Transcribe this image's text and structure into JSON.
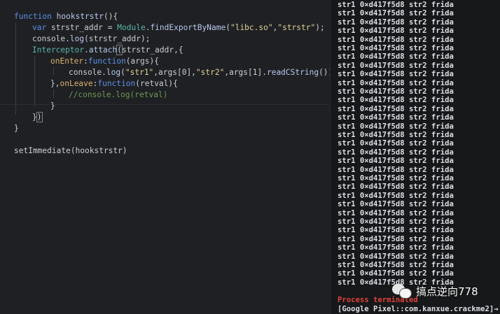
{
  "editor": {
    "lines": {
      "l1": {
        "t1": "function",
        "t2": " ",
        "t3": "hookstrstr",
        "t4": "(){"
      },
      "l2": {
        "t1": "var",
        "t2": " strstr_addr = ",
        "t3": "Module",
        "t4": ".",
        "t5": "findExportByName",
        "t6": "(",
        "t7": "\"libc.so\"",
        "t8": ",",
        "t9": "\"strstr\"",
        "t10": ");"
      },
      "l3": {
        "t1": "console",
        "t2": ".",
        "t3": "log",
        "t4": "(strstr_addr);"
      },
      "l4": {
        "t1": "Interceptor",
        "t2": ".",
        "t3": "attach",
        "t4": "(",
        "t5": "strstr_addr,{"
      },
      "l5": {
        "t1": "onEnter",
        "t2": ":",
        "t3": "function",
        "t4": "(args){"
      },
      "l6": {
        "t1": "console",
        "t2": ".",
        "t3": "log",
        "t4": "(",
        "t5": "\"str1\"",
        "t6": ",args[0],",
        "t7": "\"str2\"",
        "t8": ",args[1].",
        "t9": "readCString",
        "t10": "())"
      },
      "l7": {
        "t1": "},",
        "t2": "onLeave",
        "t3": ":",
        "t4": "function",
        "t5": "(retval){"
      },
      "l8": {
        "t1": "//console.log(retval)"
      },
      "l9": {
        "t1": "}"
      },
      "l10": {
        "t1": "}",
        "t2": ")"
      },
      "l11": {
        "t1": "}"
      },
      "l13": {
        "t1": "setImmediate",
        "t2": "(hookstrstr)"
      }
    }
  },
  "terminal": {
    "output_line": "str1 0×d417f5d8 str2 frida",
    "status": "Process terminated",
    "prompt": "[Google Pixel::com.kanxue.crackme2]→"
  },
  "watermark": {
    "text": "搞点逆向778",
    "icon": "wechat-icon"
  }
}
